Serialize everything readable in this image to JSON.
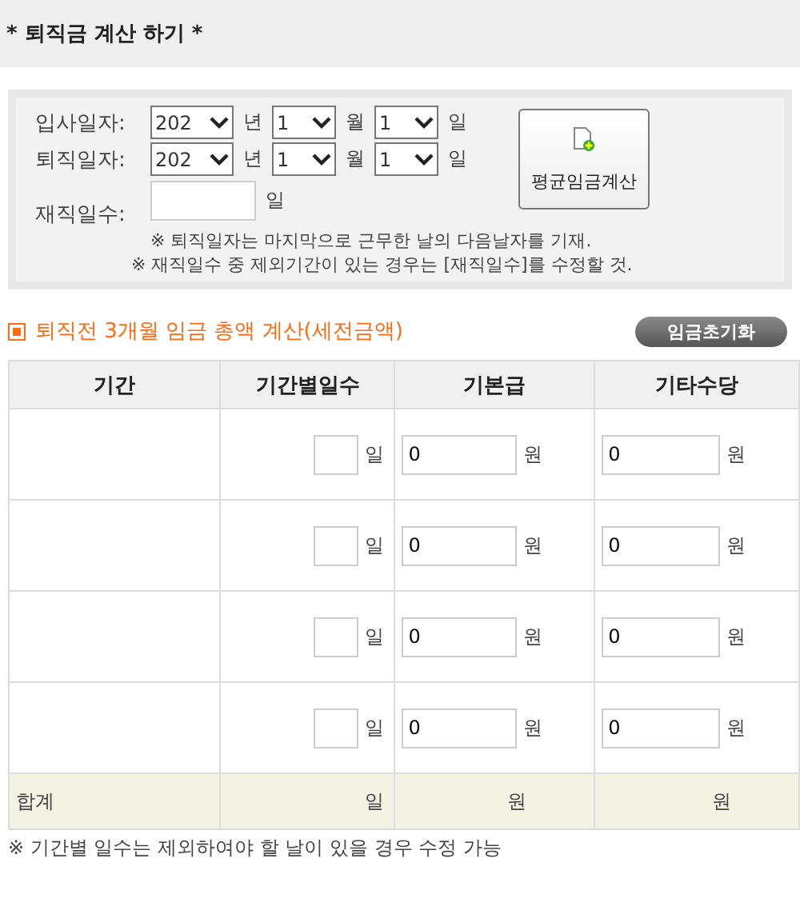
{
  "header": {
    "title": "* 퇴직금 계산 하기 *"
  },
  "form": {
    "date_rows": [
      {
        "label": "입사일자:",
        "parts": [
          {
            "value": "202",
            "unit": "년"
          },
          {
            "value": "1",
            "unit": "월"
          },
          {
            "value": "1",
            "unit": "일"
          }
        ]
      },
      {
        "label": "퇴직일자:",
        "parts": [
          {
            "value": "202",
            "unit": "년"
          },
          {
            "value": "1",
            "unit": "월"
          },
          {
            "value": "1",
            "unit": "일"
          }
        ]
      }
    ],
    "days": {
      "label": "재직일수:",
      "unit": "일"
    },
    "notes": [
      "※ 퇴직일자는 마지막으로 근무한 날의 다음날자를 기재.",
      "※ 재직일수 중 제외기간이 있는 경우는 [재직일수]를 수정할 것."
    ],
    "button": {
      "label": "평균임금계산"
    }
  },
  "section": {
    "title": "퇴직전 3개월 임금 총액 계산(세전금액)",
    "reset_button": "임금초기화"
  },
  "table": {
    "columns": [
      "기간",
      "기간별일수",
      "기본급",
      "기타수당"
    ],
    "rows": [
      {
        "days_unit": "일",
        "base": {
          "value": "0",
          "unit": "원"
        },
        "other": {
          "value": "0",
          "unit": "원"
        }
      },
      {
        "days_unit": "일",
        "base": {
          "value": "0",
          "unit": "원"
        },
        "other": {
          "value": "0",
          "unit": "원"
        }
      },
      {
        "days_unit": "일",
        "base": {
          "value": "0",
          "unit": "원"
        },
        "other": {
          "value": "0",
          "unit": "원"
        }
      },
      {
        "days_unit": "일",
        "base": {
          "value": "0",
          "unit": "원"
        },
        "other": {
          "value": "0",
          "unit": "원"
        }
      }
    ],
    "total": {
      "label": "합계",
      "days_unit": "일",
      "base_unit": "원",
      "other_unit": "원"
    }
  },
  "footnote": "※ 기간별 일수는 제외하여야 할 날이 있을 경우 수정 가능"
}
